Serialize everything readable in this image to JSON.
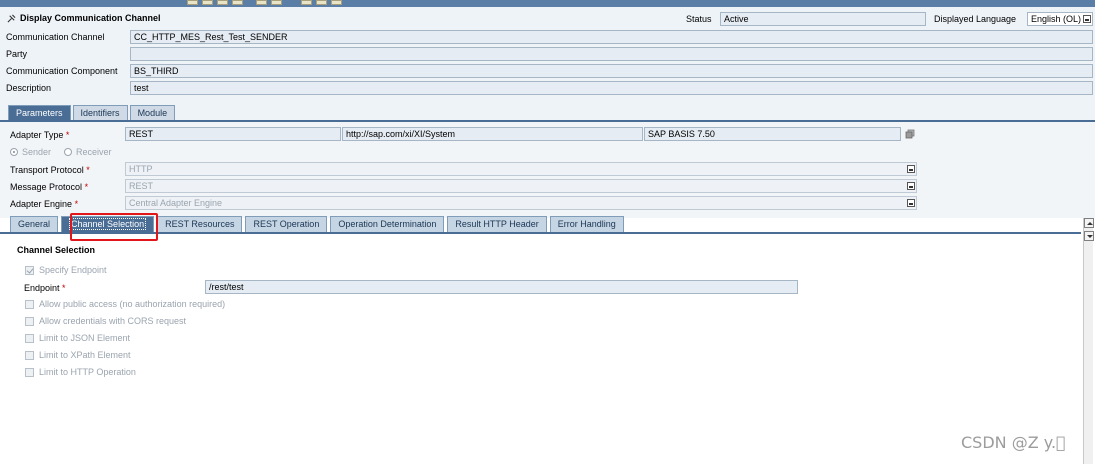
{
  "window": {
    "title": "Display Communication Channel"
  },
  "header": {
    "status_label": "Status",
    "status_value": "Active",
    "language_label": "Displayed Language",
    "language_value": "English (OL)",
    "fields": [
      {
        "label": "Communication Channel",
        "value": "CC_HTTP_MES_Rest_Test_SENDER"
      },
      {
        "label": "Party",
        "value": ""
      },
      {
        "label": "Communication Component",
        "value": "BS_THIRD"
      },
      {
        "label": "Description",
        "value": "test"
      }
    ]
  },
  "main_tabs": [
    {
      "label": "Parameters",
      "active": true
    },
    {
      "label": "Identifiers",
      "active": false
    },
    {
      "label": "Module",
      "active": false
    }
  ],
  "parameters": {
    "adapter_type_label": "Adapter Type",
    "adapter_type": "REST",
    "adapter_namespace": "http://sap.com/xi/XI/System",
    "adapter_swcv": "SAP BASIS 7.50",
    "required_mark": "*",
    "sender_label": "Sender",
    "receiver_label": "Receiver",
    "direction_selected": "Sender",
    "transport_protocol_label": "Transport Protocol",
    "transport_protocol": "HTTP",
    "message_protocol_label": "Message Protocol",
    "message_protocol": "REST",
    "adapter_engine_label": "Adapter Engine",
    "adapter_engine": "Central Adapter Engine"
  },
  "sub_tabs": [
    {
      "label": "General",
      "active": false
    },
    {
      "label": "Channel Selection",
      "active": true
    },
    {
      "label": "REST Resources",
      "active": false
    },
    {
      "label": "REST Operation",
      "active": false
    },
    {
      "label": "Operation Determination",
      "active": false
    },
    {
      "label": "Result HTTP Header",
      "active": false
    },
    {
      "label": "Error Handling",
      "active": false
    }
  ],
  "channel_selection": {
    "title": "Channel Selection",
    "specify_endpoint_label": "Specify Endpoint",
    "specify_endpoint_checked": true,
    "endpoint_label": "Endpoint",
    "endpoint_value": "/rest/test",
    "options": [
      {
        "label": "Allow public access (no authorization required)",
        "checked": false
      },
      {
        "label": "Allow credentials with CORS request",
        "checked": false
      },
      {
        "label": "Limit to JSON Element",
        "checked": false
      },
      {
        "label": "Limit to XPath Element",
        "checked": false
      },
      {
        "label": "Limit to HTTP Operation",
        "checked": false
      }
    ]
  },
  "watermark": "CSDN @Z y.\u0000",
  "colors": {
    "accent": "#4a6d95",
    "highlight": "#e0161b"
  }
}
